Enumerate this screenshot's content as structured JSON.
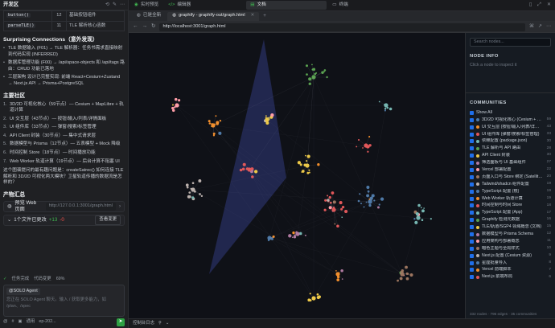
{
  "left": {
    "title": "开发区",
    "table": [
      {
        "name": "button()",
        "count": "12",
        "desc": "基础按钮组件"
      },
      {
        "name": "parseTLE()",
        "count": "11",
        "desc": "TLE 解析核心函数"
      }
    ],
    "surprising_heading": "Surprising Connections（意外发现）",
    "surprising": [
      "TLE 数据输入 (F01) → TLE 解析器：任务书需求直接映射到代码实现 (INFERRED)",
      "数据库管理功能 (F00) → /api/space-objects 和 /api/tags 路由：CRUD 功能已落地",
      "三层架构 设计已完整实现: 前端 React+Cesium+Zustand → Next.js API → Prisma+PostgreSQL"
    ],
    "communities_heading": "主要社区",
    "communities": [
      "3D/2D 可视化核心（59节点）— Cesium + MapLibre + 轨道计算",
      "UI 交互层（43节点）— 按钮/输入/列表/详情面板",
      "UI 组件库（33节点）— 弹窗/搜索/标签管理",
      "API Client 封装（30节点）— 集中式请求层",
      "数据模型与 Prisma（12节点）— 五表模型 + Mock 降级",
      "时间控制 Store（18节点）— 时间播放功能",
      "Web Worker 轨道计算（19节点）— 后台计算不阻塞 UI"
    ],
    "question": "这个图谱提问的最有趣问题是：createSatrec() 如何连接 TLE 解析和 3D/2D 可视化两大模块？卫星轨道传播的数据流是怎样的？",
    "product_heading": "产物汇总",
    "preview_label": "预览 Web 页面",
    "preview_url": "http://127.0.0.1:3001/graph.html",
    "files_label": "1个文件已更改",
    "files_add": "+13",
    "files_del": "-0",
    "files_btn": "查看变更",
    "status_task": "任务完成",
    "status_code": "代码变更",
    "status_pct": "69%",
    "agent_chip": "@SOLO Agent",
    "composer_placeholder": "您正在 SOLO Agent 聊天。输入 / 获取更多能力，如 /plan、/spec",
    "mode": "通用",
    "model": "ep-202..."
  },
  "browser": {
    "top_tabs": [
      {
        "label": "实时预览",
        "active": false
      },
      {
        "label": "编辑器",
        "active": false
      },
      {
        "label": "文档",
        "active": true
      },
      {
        "label": "终端",
        "active": false
      }
    ],
    "browser_tabs": [
      {
        "label": "已是全新",
        "active": false
      },
      {
        "label": "graphify - graphify-out/graph.html",
        "active": true
      }
    ],
    "url": "http://localhost:3001/graph.html",
    "bottom_label": "控制台日志"
  },
  "sidebar": {
    "search_placeholder": "Search nodes...",
    "node_info_heading": "NODE INFO",
    "node_info_text": "Click a node to inspect it",
    "communities_heading": "COMMUNITIES",
    "show_all": "Show All",
    "items": [
      {
        "label": "3D/2D 可视化核心 (Cesium + M…",
        "count": "59",
        "color": "#4e79a7"
      },
      {
        "label": "UI 交互层 (按钮/输入/列表/详…",
        "count": "43",
        "color": "#f28e2b"
      },
      {
        "label": "UI 组件库 (弹窗/搜索/标签管理)",
        "count": "33",
        "color": "#e15759"
      },
      {
        "label": "依赖配置 (package.json)",
        "count": "30",
        "color": "#76b7b2"
      },
      {
        "label": "TLE 解析与 API 路由",
        "count": "28",
        "color": "#59a14f"
      },
      {
        "label": "API Client 封装",
        "count": "30",
        "color": "#edc948"
      },
      {
        "label": "筛选面板与 UI 基础组件",
        "count": "27",
        "color": "#b07aa1"
      },
      {
        "label": "Vercel 部署配置",
        "count": "22",
        "color": "#ff9da7"
      },
      {
        "label": "页面入口与 Store 绑定 (Satellite…",
        "count": "20",
        "color": "#9c755f"
      },
      {
        "label": "Tailwind/shadcn 组件配置",
        "count": "19",
        "color": "#bab0ac"
      },
      {
        "label": "TypeScript 配置 (根)",
        "count": "19",
        "color": "#4e79a7"
      },
      {
        "label": "Web Worker 轨道计算",
        "count": "19",
        "color": "#f28e2b"
      },
      {
        "label": "时间控制与时间 Store",
        "count": "18",
        "color": "#e15759"
      },
      {
        "label": "TypeScript 配置 (App)",
        "count": "17",
        "color": "#76b7b2"
      },
      {
        "label": "Graphify 检测元数据",
        "count": "16",
        "color": "#59a14f"
      },
      {
        "label": "TLE/轨道/SGP4 领域概念 (文档)",
        "count": "15",
        "color": "#edc948"
      },
      {
        "label": "数据模型与 Prisma Schema",
        "count": "12",
        "color": "#b07aa1"
      },
      {
        "label": "应用架构与部署概念",
        "count": "11",
        "color": "#ff9da7"
      },
      {
        "label": "暗色主题与全局样式",
        "count": "10",
        "color": "#9c755f"
      },
      {
        "label": "Next.js 配置 (Cesium 资源)",
        "count": "9",
        "color": "#bab0ac"
      },
      {
        "label": "星座批量导入",
        "count": "8",
        "color": "#4e79a7"
      },
      {
        "label": "Vercel 前端脚本",
        "count": "7",
        "color": "#f28e2b"
      },
      {
        "label": "Next.js 前端布局",
        "count": "6",
        "color": "#e15759"
      }
    ],
    "footer": "332 nodes · 796 edges · 35 communities"
  }
}
